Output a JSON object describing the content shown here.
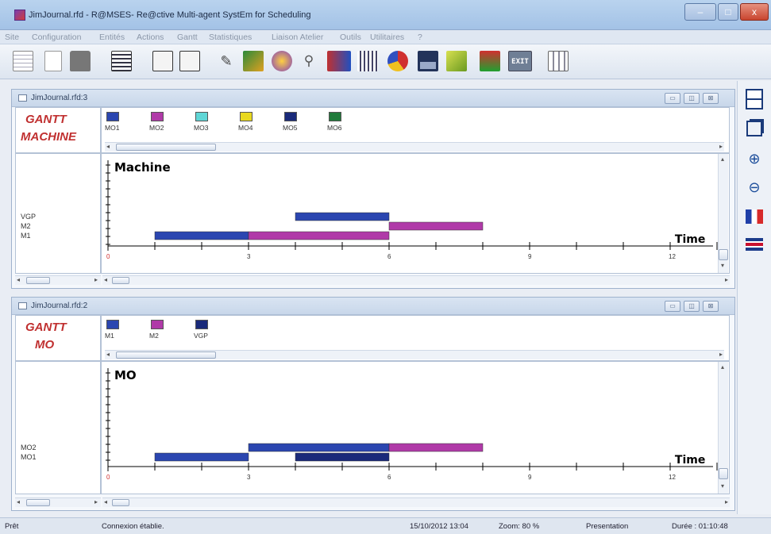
{
  "window": {
    "title": "JimJournal.rfd - R@MSES- Re@ctive Multi-agent SystEm for Scheduling",
    "minimize": "‒",
    "maximize": "□",
    "close": "x"
  },
  "menu": [
    "Site",
    "Configuration",
    "Entités",
    "Actions",
    "Gantt",
    "Statistiques",
    "Liaison Atelier",
    "Outils",
    "Utilitaires",
    "?"
  ],
  "toolbar_exit_label": "EXIT",
  "panel_top": {
    "title": "JimJournal.rfd:3",
    "heading_line1": "GANTT",
    "heading_line2": "MACHINE",
    "legend": [
      {
        "label": "MO1",
        "color": "#2b46b0"
      },
      {
        "label": "MO2",
        "color": "#b03aa8"
      },
      {
        "label": "MO3",
        "color": "#5fd6d6"
      },
      {
        "label": "MO4",
        "color": "#e8d820"
      },
      {
        "label": "MO5",
        "color": "#1a2a7a"
      },
      {
        "label": "MO6",
        "color": "#1f7a3a"
      }
    ],
    "chart_data": {
      "type": "gantt",
      "title": "Machine",
      "xlabel": "Time",
      "xlim": [
        0,
        13
      ],
      "x_ticks": [
        "0",
        "3",
        "6",
        "9",
        "12"
      ],
      "rows": [
        "VGP",
        "M2",
        "M1"
      ],
      "bars": [
        {
          "row": "VGP",
          "start": 4,
          "end": 6,
          "job": "MO1",
          "color": "#2b46b0"
        },
        {
          "row": "M2",
          "start": 6,
          "end": 8,
          "job": "MO2",
          "color": "#b03aa8"
        },
        {
          "row": "M1",
          "start": 1,
          "end": 3,
          "job": "MO1",
          "color": "#2b46b0"
        },
        {
          "row": "M1",
          "start": 3,
          "end": 6,
          "job": "MO2",
          "color": "#b03aa8"
        }
      ]
    }
  },
  "panel_bottom": {
    "title": "JimJournal.rfd:2",
    "heading_line1": "GANTT",
    "heading_line2": "MO",
    "legend": [
      {
        "label": "M1",
        "color": "#2b46b0"
      },
      {
        "label": "M2",
        "color": "#b03aa8"
      },
      {
        "label": "VGP",
        "color": "#1a2a7a"
      }
    ],
    "chart_data": {
      "type": "gantt",
      "title": "MO",
      "xlabel": "Time",
      "xlim": [
        0,
        13
      ],
      "x_ticks": [
        "0",
        "3",
        "6",
        "9",
        "12"
      ],
      "rows": [
        "MO2",
        "MO1"
      ],
      "bars": [
        {
          "row": "MO2",
          "start": 3,
          "end": 6,
          "job": "M1",
          "color": "#2b46b0"
        },
        {
          "row": "MO2",
          "start": 6,
          "end": 8,
          "job": "M2",
          "color": "#b03aa8"
        },
        {
          "row": "MO1",
          "start": 1,
          "end": 3,
          "job": "M1",
          "color": "#2b46b0"
        },
        {
          "row": "MO1",
          "start": 4,
          "end": 6,
          "job": "VGP",
          "color": "#1a2a7a"
        }
      ]
    }
  },
  "status": {
    "state": "Prêt",
    "connection": "Connexion établie.",
    "datetime": "15/10/2012 13:04",
    "zoom": "Zoom: 80 %",
    "mode": "Presentation",
    "duration": "Durée : 01:10:48"
  }
}
